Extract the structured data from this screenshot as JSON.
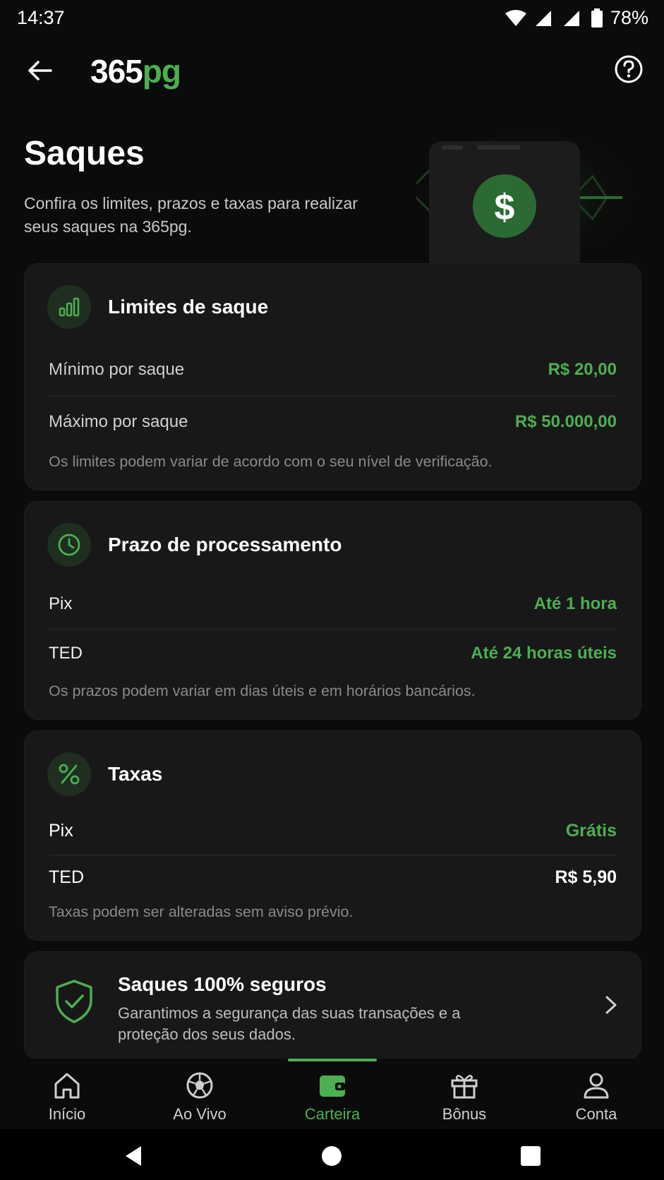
{
  "status": {
    "time": "14:37",
    "battery": "78%"
  },
  "header": {
    "logo_main": "365",
    "logo_accent": "pg"
  },
  "hero": {
    "title": "Saques",
    "subtitle": "Confira os limites, prazos e taxas para realizar seus saques na 365pg."
  },
  "limits": {
    "title": "Limites de saque",
    "rows": [
      {
        "label": "Mínimo por saque",
        "value": "R$ 20,00"
      },
      {
        "label": "Máximo por saque",
        "value": "R$ 50.000,00"
      }
    ],
    "note": "Os limites podem variar de acordo com o seu nível de verificação."
  },
  "processing": {
    "title": "Prazo de processamento",
    "rows": [
      {
        "label": "Pix",
        "value": "Até 1 hora"
      },
      {
        "label": "TED",
        "value": "Até 24 horas úteis"
      }
    ],
    "note": "Os prazos podem variar em dias úteis e em horários bancários."
  },
  "fees": {
    "title": "Taxas",
    "rows": [
      {
        "label": "Pix",
        "value": "Grátis"
      },
      {
        "label": "TED",
        "value": "R$ 5,90"
      }
    ],
    "note": "Taxas podem ser alteradas sem aviso prévio."
  },
  "secure": {
    "title": "Saques 100% seguros",
    "text": "Garantimos a segurança das suas transações e a proteção dos seus dados."
  },
  "tabs": [
    {
      "label": "Início",
      "icon": "home-icon"
    },
    {
      "label": "Ao Vivo",
      "icon": "soccer-ball-icon"
    },
    {
      "label": "Carteira",
      "icon": "wallet-icon",
      "active": true
    },
    {
      "label": "Bônus",
      "icon": "gift-icon"
    },
    {
      "label": "Conta",
      "icon": "user-icon"
    }
  ],
  "colors": {
    "accent": "#4caf50",
    "background": "#0b0b0b",
    "card": "#181818"
  }
}
